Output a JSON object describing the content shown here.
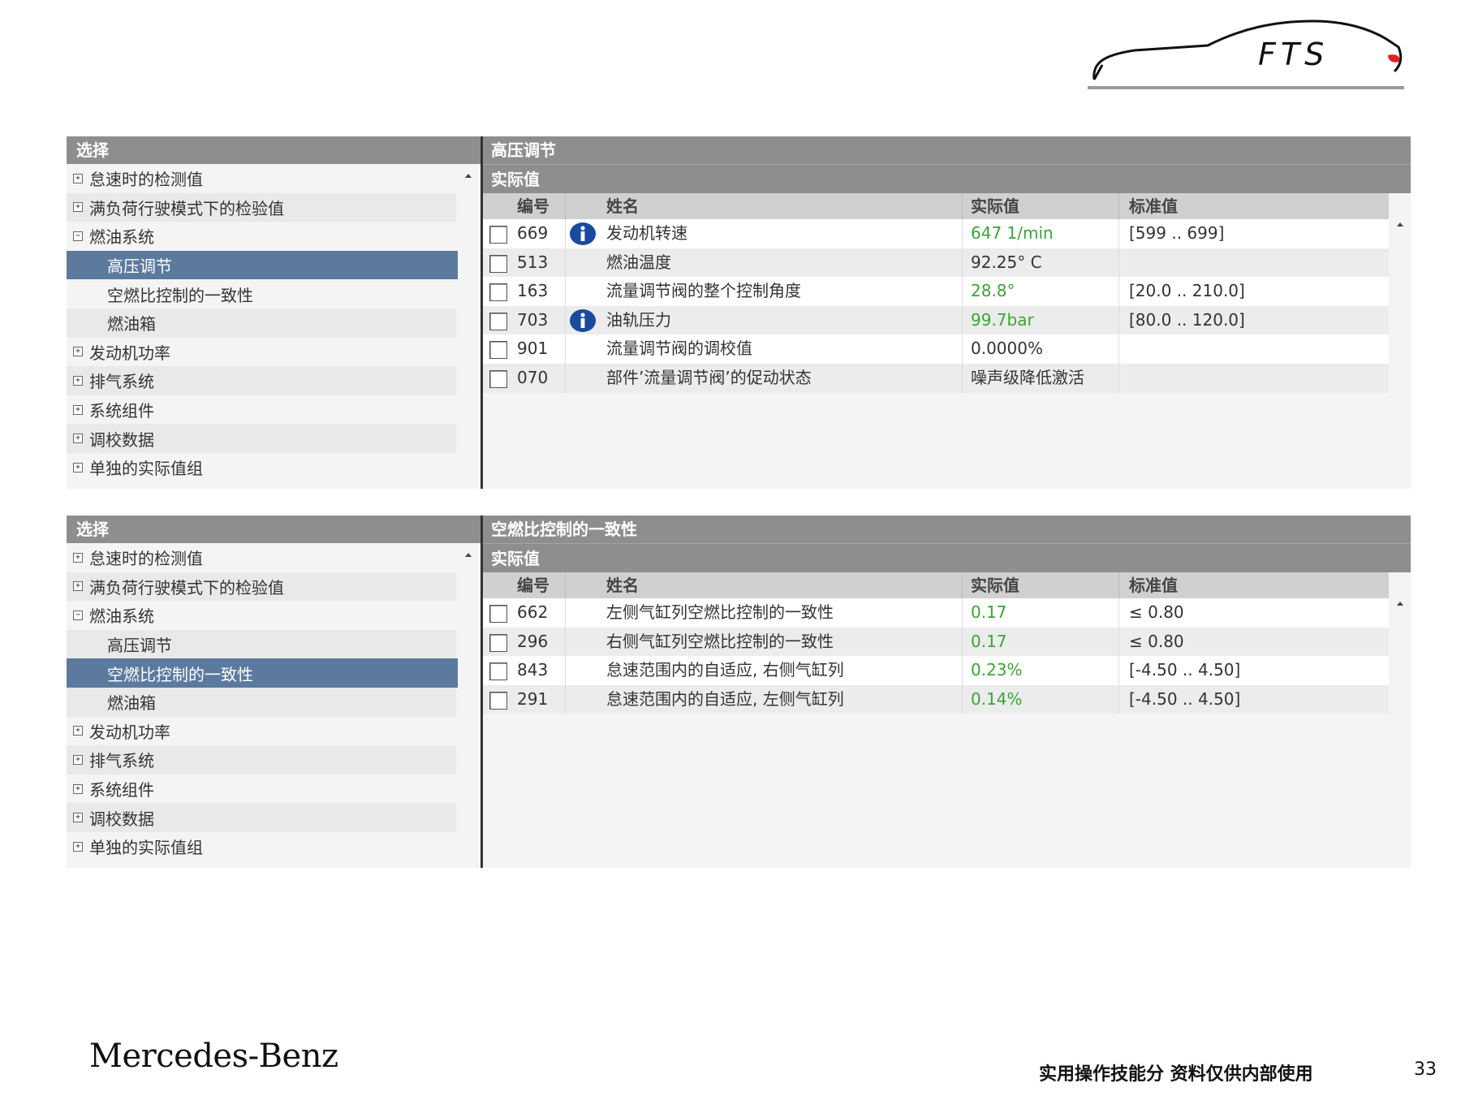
{
  "logo": {
    "text": "FTS",
    "accent": "#e02020"
  },
  "tree_items": [
    {
      "label": "怠速时的检测值",
      "toggle": "+",
      "child": false
    },
    {
      "label": "满负荷行驶模式下的检验值",
      "toggle": "+",
      "child": false
    },
    {
      "label": "燃油系统",
      "toggle": "−",
      "child": false
    },
    {
      "label": "高压调节",
      "toggle": "",
      "child": true
    },
    {
      "label": "空燃比控制的一致性",
      "toggle": "",
      "child": true
    },
    {
      "label": "燃油箱",
      "toggle": "",
      "child": true
    },
    {
      "label": "发动机功率",
      "toggle": "+",
      "child": false
    },
    {
      "label": "排气系统",
      "toggle": "+",
      "child": false
    },
    {
      "label": "系统组件",
      "toggle": "+",
      "child": false
    },
    {
      "label": "调校数据",
      "toggle": "+",
      "child": false
    },
    {
      "label": "单独的实际值组",
      "toggle": "+",
      "child": false
    }
  ],
  "columns": {
    "id": "编号",
    "name": "姓名",
    "actual": "实际值",
    "standard": "标准值"
  },
  "panel_top": {
    "left_header": "选择",
    "selected_index": 3,
    "title": "高压调节",
    "subtitle": "实际值",
    "rows": [
      {
        "id": "669",
        "info": true,
        "name": "发动机转速",
        "actual": "647 1/min",
        "green": true,
        "standard": "[599 .. 699]"
      },
      {
        "id": "513",
        "info": false,
        "name": "燃油温度",
        "actual": "92.25° C",
        "green": false,
        "standard": ""
      },
      {
        "id": "163",
        "info": false,
        "name": "流量调节阀的整个控制角度",
        "actual": "28.8°",
        "green": true,
        "standard": "[20.0 .. 210.0]"
      },
      {
        "id": "703",
        "info": true,
        "name": "油轨压力",
        "actual": "99.7bar",
        "green": true,
        "standard": "[80.0 .. 120.0]"
      },
      {
        "id": "901",
        "info": false,
        "name": "流量调节阀的调校值",
        "actual": "0.0000%",
        "green": false,
        "standard": ""
      },
      {
        "id": "070",
        "info": false,
        "name": "部件’流量调节阀’的促动状态",
        "actual": "噪声级降低激活",
        "green": false,
        "standard": ""
      }
    ]
  },
  "panel_bottom": {
    "left_header": "选择",
    "selected_index": 4,
    "title": "空燃比控制的一致性",
    "subtitle": "实际值",
    "rows": [
      {
        "id": "662",
        "info": false,
        "name": "左侧气缸列空燃比控制的一致性",
        "actual": "0.17",
        "green": true,
        "standard": "≤ 0.80"
      },
      {
        "id": "296",
        "info": false,
        "name": "右侧气缸列空燃比控制的一致性",
        "actual": "0.17",
        "green": true,
        "standard": "≤ 0.80"
      },
      {
        "id": "843",
        "info": false,
        "name": "怠速范围内的自适应, 右侧气缸列",
        "actual": "0.23%",
        "green": true,
        "standard": "[-4.50 .. 4.50]"
      },
      {
        "id": "291",
        "info": false,
        "name": "怠速范围内的自适应, 左侧气缸列",
        "actual": "0.14%",
        "green": true,
        "standard": "[-4.50 .. 4.50]"
      }
    ]
  },
  "footer": {
    "brand": "Mercedes-Benz",
    "note": "实用操作技能分 资料仅供内部使用",
    "page": "33"
  },
  "colors": {
    "selected": "#5b7a9e",
    "green_value": "#3aa534",
    "header_gray": "#8e8e8e",
    "info_blue": "#1a4aa0"
  }
}
